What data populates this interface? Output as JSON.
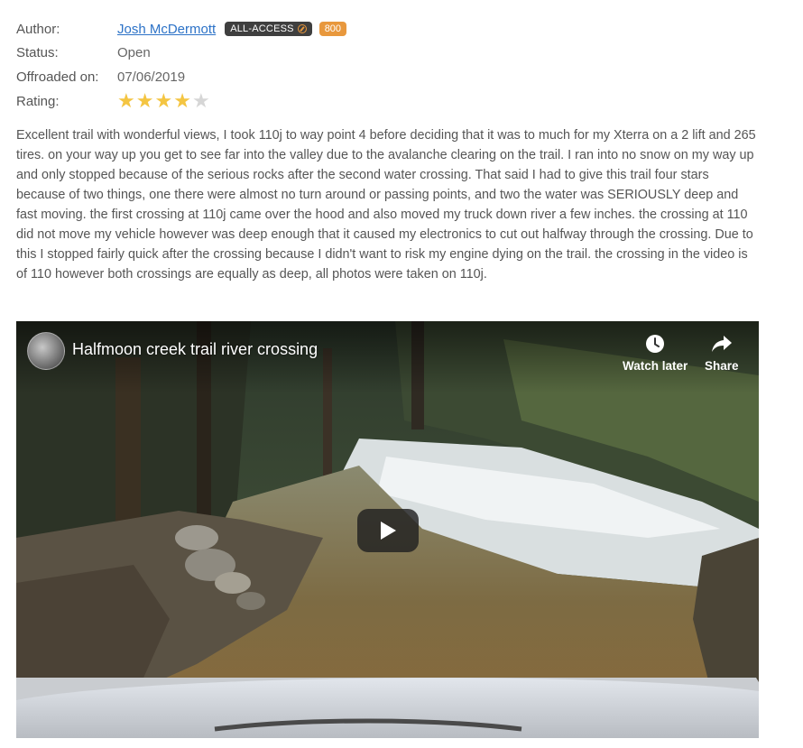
{
  "review_meta": {
    "author_label": "Author:",
    "author_name": "Josh McDermott",
    "access_badge": "ALL-ACCESS",
    "points_badge": "800",
    "status_label": "Status:",
    "status_value": "Open",
    "offroaded_label": "Offroaded on:",
    "offroaded_value": "07/06/2019",
    "rating_label": "Rating:",
    "rating": 4,
    "rating_max": 5
  },
  "review_text": "Excellent trail with wonderful views, I took 110j to way point 4 before deciding that it was to much for my Xterra on a 2 lift and 265 tires. on your way up you get to see far into the valley due to the avalanche clearing on the trail. I ran into no snow on my way up and only stopped because of the serious rocks after the second water crossing. That said I had to give this trail four stars because of two things, one there were almost no turn around or passing points, and two the water was SERIOUSLY deep and fast moving. the first crossing at 110j came over the hood and also moved my truck down river a few inches. the crossing at 110 did not move my vehicle however was deep enough that it caused my electronics to cut out halfway through the crossing. Due to this I stopped fairly quick after the crossing because I didn't want to risk my engine dying on the trail. the crossing in the video is of 110 however both crossings are equally as deep, all photos were taken on 110j.",
  "video": {
    "title": "Halfmoon creek trail river crossing",
    "watch_later_label": "Watch later",
    "share_label": "Share"
  },
  "colors": {
    "link": "#2c72c7",
    "badge_dark": "#3f3f3f",
    "badge_orange": "#e8983d",
    "star_on": "#f4c542",
    "star_off": "#d6d6d6"
  }
}
